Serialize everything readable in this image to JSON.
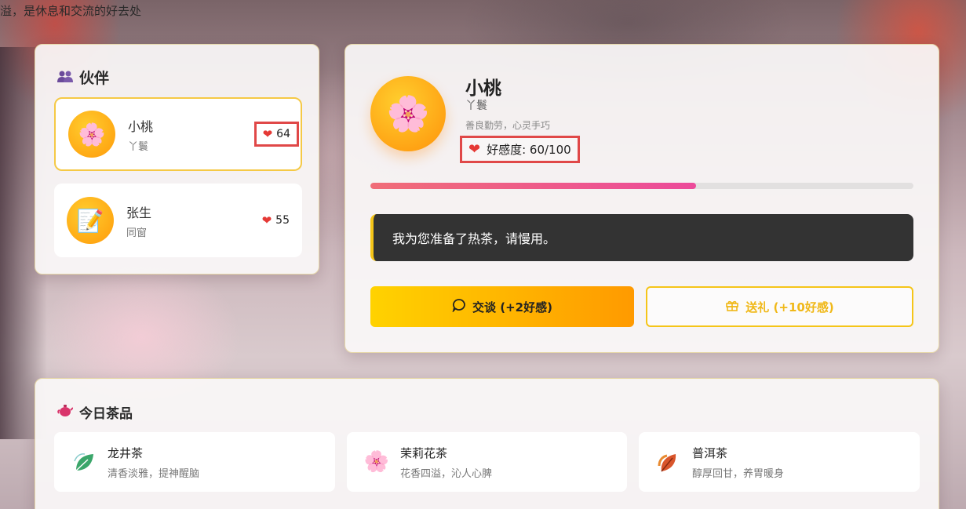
{
  "header": {
    "text": "溢，是休息和交流的好去处"
  },
  "partners": {
    "title": "伙伴",
    "icon": "people-icon",
    "items": [
      {
        "name": "小桃",
        "role": "丫鬟",
        "affinity": "64",
        "icon": "cherry-blossom-icon"
      },
      {
        "name": "张生",
        "role": "同窗",
        "affinity": "55",
        "icon": "memo-pencil-icon"
      }
    ]
  },
  "detail": {
    "name": "小桃",
    "role": "丫鬟",
    "description": "善良勤劳，心灵手巧",
    "affinity_text": "好感度: 60/100",
    "affinity_value": 60,
    "affinity_max": 100,
    "dialog": "我为您准备了热茶，请慢用。",
    "talk_button": "交谈 (+2好感)",
    "gift_button": "送礼 (+10好感)",
    "accent_color": "#f5c518",
    "heart_color": "#e53935"
  },
  "tea": {
    "title": "今日茶品",
    "icon": "teapot-icon",
    "items": [
      {
        "name": "龙井茶",
        "desc": "清香淡雅，提神醒脑",
        "icon": "green-leaf-icon"
      },
      {
        "name": "茉莉花茶",
        "desc": "花香四溢，沁人心脾",
        "icon": "cherry-blossom-icon"
      },
      {
        "name": "普洱茶",
        "desc": "醇厚回甘，养胃暖身",
        "icon": "autumn-leaf-icon"
      }
    ]
  }
}
